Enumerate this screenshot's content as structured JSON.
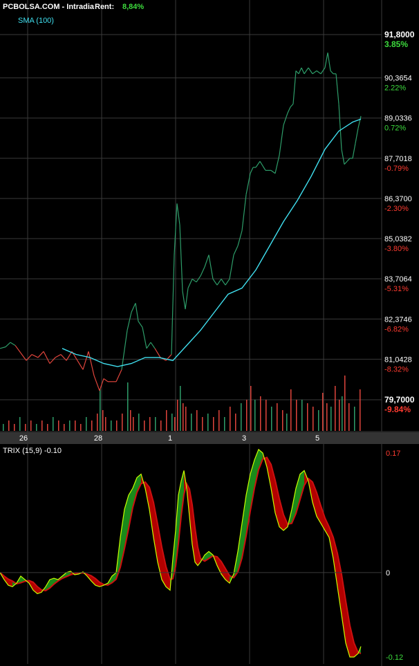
{
  "header": {
    "site": "PCBOLSA.COM - Intradia",
    "rent_label": "Rent:",
    "rent_value": "8,84%"
  },
  "colors": {
    "background": "#000000",
    "grid": "#3a3a3a",
    "up": "#2e9e6a",
    "down": "#e0453c",
    "sma": "#40e0f0",
    "pct_up": "#3ddc3d",
    "pct_down": "#ff3b30",
    "trix_fill_up": "#1a8a1a",
    "trix_fill_down": "#b30000",
    "trix_line": "#c8ff00",
    "trix_signal": "#cc1010",
    "x_axis_bar": "#333333"
  },
  "chart_data": [
    {
      "type": "line",
      "title": "PCBOLSA.COM - Intradia",
      "legend": [
        "SMA (100)"
      ],
      "y_ticks": [
        "91,8000",
        "90,3654",
        "89,0336",
        "87,7018",
        "86,3700",
        "85,0382",
        "83,7064",
        "82,3746",
        "81,0428",
        "79,7000"
      ],
      "pct_ticks": [
        "3.85%",
        "2.22%",
        "0.72%",
        "-0.79%",
        "-2.30%",
        "-3.80%",
        "-5.31%",
        "-6.82%",
        "-8.32%",
        "-9.84%"
      ],
      "x_ticks": [
        "26",
        "28",
        "1",
        "3",
        "5"
      ],
      "ylim": [
        79.7,
        91.8
      ],
      "series": [
        {
          "name": "price",
          "x": [
            0,
            8,
            15,
            22,
            30,
            38,
            46,
            55,
            63,
            72,
            80,
            88,
            96,
            104,
            112,
            120,
            128,
            136,
            144,
            150,
            156,
            162,
            168,
            176,
            184,
            190,
            196,
            200,
            206,
            212,
            218,
            224,
            232,
            240,
            248,
            252,
            256,
            260,
            264,
            268,
            272,
            278,
            284,
            290,
            296,
            302,
            308,
            314,
            320,
            326,
            332,
            338,
            344,
            350,
            356,
            362,
            366,
            370,
            376,
            384,
            392,
            398,
            404,
            410,
            416,
            420,
            424,
            428,
            432,
            436,
            440,
            446,
            452,
            458,
            464,
            470,
            474,
            478,
            482,
            486,
            490,
            494,
            498,
            502,
            506,
            510,
            514,
            518,
            522
          ],
          "values": [
            81.4,
            81.45,
            81.6,
            81.5,
            81.25,
            81.0,
            81.2,
            81.1,
            81.3,
            80.9,
            81.1,
            81.2,
            81.0,
            81.3,
            81.0,
            80.7,
            81.3,
            80.5,
            80.0,
            80.4,
            80.3,
            80.3,
            80.3,
            80.7,
            82.0,
            82.6,
            82.9,
            82.3,
            82.1,
            81.4,
            81.6,
            81.4,
            81.1,
            81.0,
            81.2,
            84.5,
            86.2,
            85.5,
            83.3,
            82.7,
            83.4,
            83.7,
            83.6,
            83.8,
            84.1,
            84.5,
            83.7,
            83.5,
            83.7,
            83.5,
            83.7,
            84.5,
            84.8,
            85.3,
            86.5,
            87.2,
            87.4,
            87.4,
            87.6,
            87.3,
            87.3,
            87.2,
            87.8,
            88.8,
            89.2,
            89.4,
            89.5,
            90.6,
            90.5,
            90.7,
            90.5,
            90.7,
            90.5,
            90.6,
            90.5,
            90.7,
            91.2,
            90.6,
            90.5,
            90.5,
            89.5,
            88.0,
            87.5,
            87.6,
            87.7,
            87.7,
            88.2,
            88.7,
            89.1
          ]
        },
        {
          "name": "SMA (100)",
          "x": [
            90,
            110,
            130,
            150,
            170,
            190,
            210,
            230,
            250,
            270,
            290,
            310,
            330,
            350,
            370,
            390,
            410,
            430,
            450,
            470,
            490,
            510,
            522
          ],
          "values": [
            81.4,
            81.2,
            81.1,
            80.9,
            80.8,
            80.9,
            81.1,
            81.1,
            81.0,
            81.5,
            82.0,
            82.6,
            83.2,
            83.4,
            84.0,
            84.8,
            85.6,
            86.3,
            87.1,
            88.0,
            88.6,
            88.9,
            89.0
          ]
        }
      ],
      "volume": {
        "x": [
          4,
          12,
          20,
          28,
          36,
          44,
          52,
          60,
          68,
          76,
          84,
          92,
          100,
          108,
          116,
          124,
          132,
          140,
          144,
          148,
          152,
          160,
          168,
          176,
          184,
          188,
          192,
          200,
          208,
          216,
          224,
          232,
          240,
          248,
          252,
          256,
          260,
          264,
          268,
          276,
          284,
          292,
          300,
          308,
          316,
          324,
          332,
          340,
          348,
          356,
          362,
          368,
          376,
          384,
          392,
          400,
          408,
          414,
          420,
          428,
          436,
          444,
          452,
          460,
          466,
          472,
          478,
          484,
          490,
          494,
          498,
          504,
          512,
          520
        ],
        "values": [
          2,
          3,
          2,
          4,
          2,
          3,
          2,
          3,
          2,
          4,
          3,
          2,
          3,
          3,
          2,
          4,
          3,
          5,
          12,
          6,
          4,
          3,
          3,
          5,
          14,
          6,
          4,
          5,
          3,
          4,
          4,
          3,
          6,
          5,
          4,
          9,
          13,
          8,
          7,
          5,
          6,
          4,
          5,
          4,
          6,
          4,
          7,
          5,
          8,
          9,
          13,
          9,
          10,
          9,
          7,
          8,
          6,
          5,
          12,
          9,
          9,
          8,
          7,
          6,
          11,
          8,
          7,
          13,
          9,
          10,
          16,
          8,
          7,
          12
        ]
      },
      "ylabel": "",
      "xlabel": ""
    },
    {
      "type": "line",
      "legend": [
        "TRIX (15,9) -0.10"
      ],
      "y_ticks": [
        "0.17",
        "0",
        "-0.12"
      ],
      "ylim": [
        -0.12,
        0.17
      ],
      "series": [
        {
          "name": "TRIX (15,9) -0.10",
          "x": [
            0,
            6,
            12,
            18,
            24,
            30,
            36,
            42,
            48,
            54,
            60,
            66,
            72,
            78,
            84,
            90,
            96,
            102,
            108,
            114,
            120,
            126,
            132,
            138,
            144,
            150,
            156,
            162,
            168,
            174,
            180,
            186,
            192,
            198,
            204,
            210,
            216,
            222,
            228,
            234,
            240,
            246,
            250,
            254,
            258,
            262,
            266,
            270,
            274,
            278,
            282,
            286,
            290,
            296,
            302,
            308,
            314,
            320,
            326,
            332,
            338,
            344,
            350,
            356,
            362,
            368,
            374,
            380,
            386,
            392,
            398,
            404,
            410,
            416,
            422,
            428,
            434,
            440,
            446,
            452,
            458,
            464,
            470,
            476,
            482,
            488,
            494,
            500,
            506,
            512,
            518,
            522
          ],
          "values": [
            0.0,
            -0.01,
            -0.018,
            -0.02,
            -0.015,
            -0.005,
            -0.01,
            -0.015,
            -0.025,
            -0.03,
            -0.028,
            -0.02,
            -0.01,
            -0.008,
            -0.01,
            -0.005,
            0.0,
            0.002,
            -0.003,
            -0.002,
            0.001,
            -0.005,
            -0.012,
            -0.018,
            -0.02,
            -0.018,
            -0.015,
            -0.005,
            0.0,
            0.05,
            0.09,
            0.11,
            0.12,
            0.135,
            0.14,
            0.12,
            0.09,
            0.05,
            0.015,
            -0.01,
            -0.02,
            -0.025,
            0.02,
            0.06,
            0.11,
            0.13,
            0.145,
            0.12,
            0.08,
            0.04,
            0.015,
            0.01,
            0.015,
            0.025,
            0.03,
            0.025,
            0.01,
            -0.002,
            -0.01,
            -0.015,
            -0.002,
            0.03,
            0.07,
            0.11,
            0.14,
            0.16,
            0.175,
            0.17,
            0.15,
            0.12,
            0.085,
            0.065,
            0.06,
            0.065,
            0.09,
            0.12,
            0.14,
            0.145,
            0.13,
            0.1,
            0.08,
            0.07,
            0.06,
            0.05,
            0.02,
            -0.02,
            -0.06,
            -0.1,
            -0.12,
            -0.12,
            -0.115,
            -0.105
          ]
        }
      ]
    }
  ]
}
